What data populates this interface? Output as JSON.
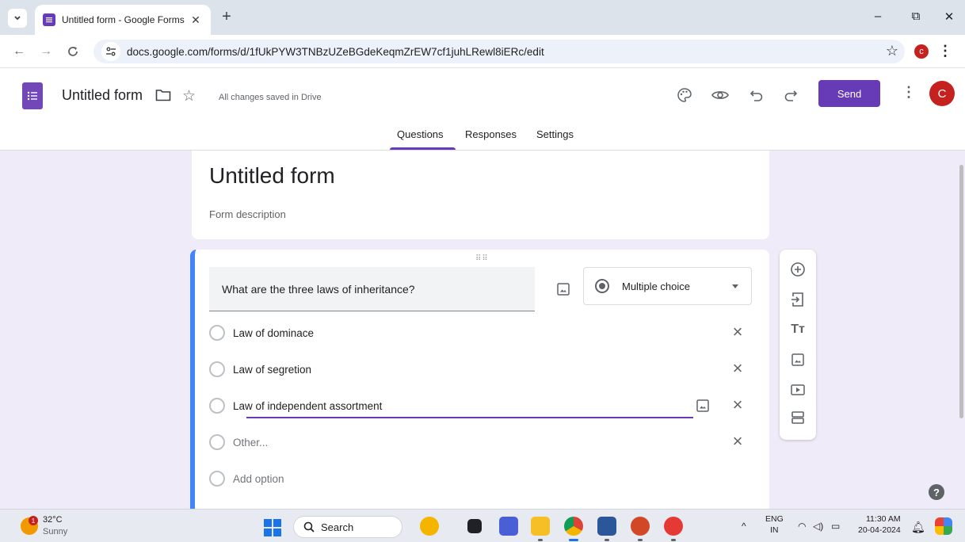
{
  "browser": {
    "tab_title": "Untitled form - Google Forms",
    "tab_close": "✕",
    "new_tab": "+",
    "url": "docs.google.com/forms/d/1fUkPYW3TNBzUZeBGdeKeqmZrEW7cf1juhLRewl8iERc/edit",
    "profile_letter": "c",
    "window_controls": {
      "minimize": "–",
      "restore": "⧉",
      "close": "✕"
    }
  },
  "app": {
    "title": "Untitled form",
    "save_status": "All changes saved in Drive",
    "send_label": "Send",
    "avatar_letter": "C",
    "tabs": [
      {
        "label": "Questions",
        "active": true
      },
      {
        "label": "Responses",
        "active": false
      },
      {
        "label": "Settings",
        "active": false
      }
    ],
    "accent_color": "#673ab7",
    "header_icons": [
      "palette-icon",
      "preview-eye-icon",
      "undo-icon",
      "redo-icon",
      "more-vert-icon"
    ]
  },
  "form": {
    "title": "Untitled form",
    "description_placeholder": "Form description",
    "question": {
      "text": "What are the three laws of inheritance?",
      "type": "Multiple choice",
      "options": [
        {
          "label": "Law of dominace",
          "muted": false
        },
        {
          "label": "Law of segretion",
          "muted": false
        },
        {
          "label": "Law of independent assortment",
          "muted": false,
          "editing": true
        },
        {
          "label": "Other...",
          "muted": true
        }
      ],
      "add_option_label": "Add option",
      "border_color": "#4285f4"
    }
  },
  "side_toolbar": [
    "add-question-icon",
    "import-questions-icon",
    "add-title-icon",
    "add-image-icon",
    "add-video-icon",
    "add-section-icon"
  ],
  "taskbar": {
    "weather_temp": "32°C",
    "weather_desc": "Sunny",
    "weather_badge": "1",
    "search_label": "Search",
    "lang_top": "ENG",
    "lang_bottom": "IN",
    "time": "11:30 AM",
    "date": "20-04-2024"
  }
}
